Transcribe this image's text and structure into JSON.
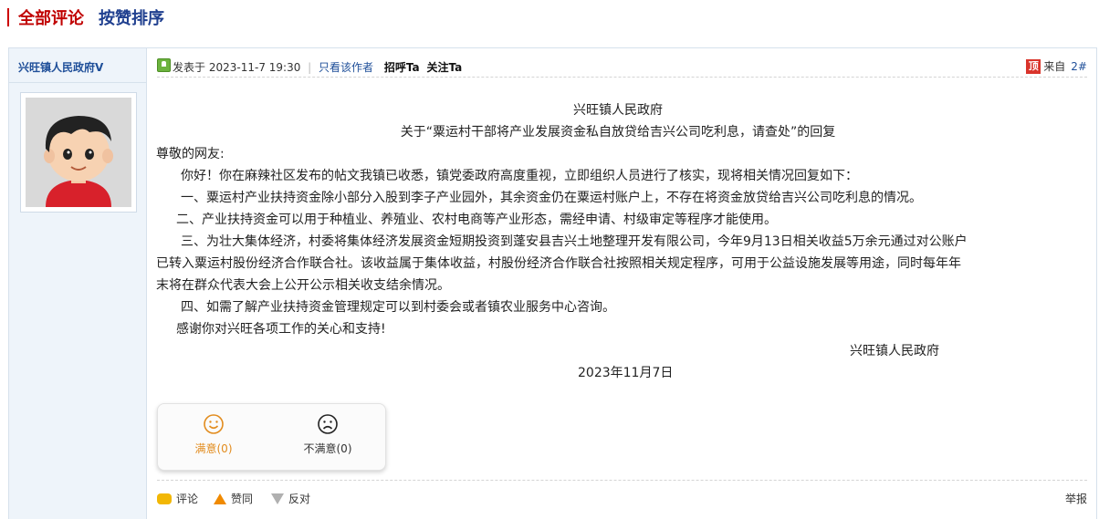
{
  "header": {
    "all_comments": "全部评论",
    "sort_by_likes": "按赞排序"
  },
  "author": {
    "name": "兴旺镇人民政府V",
    "avatar_icon": "cartoon-boy-avatar"
  },
  "meta": {
    "posted_at_label": "发表于",
    "posted_at": "2023-11-7 19:30",
    "only_author": "只看该作者",
    "greet": "招呼Ta",
    "follow": "关注Ta",
    "top_badge": "顶",
    "from_label": "来自",
    "floor": "2#"
  },
  "body": {
    "title1": "兴旺镇人民政府",
    "title2": "关于“粟运村干部将产业发展资金私自放贷给吉兴公司吃利息，请查处”的回复",
    "greeting": "尊敬的网友:",
    "p1": "你好！你在麻辣社区发布的帖文我镇已收悉，镇党委政府高度重视，立即组织人员进行了核实，现将相关情况回复如下：",
    "p2": "一、粟运村产业扶持资金除小部分入股到李子产业园外，其余资金仍在粟运村账户上，不存在将资金放贷给吉兴公司吃利息的情况。",
    "p3": "二、产业扶持资金可以用于种植业、养殖业、农村电商等产业形态，需经申请、村级审定等程序才能使用。",
    "p4a": "三、为壮大集体经济，村委将集体经济发展资金短期投资到蓬安县吉兴土地整理开发有限公司，今年9月13日相关收益5万余元通过对公账户",
    "p4b": "已转入粟运村股份经济合作联合社。该收益属于集体收益，村股份经济合作联合社按照相关规定程序，可用于公益设施发展等用途，同时每年年",
    "p4c": "末将在群众代表大会上公开公示相关收支结余情况。",
    "p5": "四、如需了解产业扶持资金管理规定可以到村委会或者镇农业服务中心咨询。",
    "p6": "感谢你对兴旺各项工作的关心和支持!",
    "signature": "兴旺镇人民政府",
    "date": "2023年11月7日"
  },
  "rating": {
    "satisfied": "满意(0)",
    "unsatisfied": "不满意(0)"
  },
  "actions": {
    "comment": "评论",
    "like": "赞同",
    "oppose": "反对",
    "report": "举报"
  },
  "colors": {
    "header_red": "#c00000",
    "header_blue": "#1f3f8f",
    "link_blue": "#1f4f99",
    "satisfied_orange": "#e28c1e",
    "top_badge_red": "#d9342b"
  }
}
